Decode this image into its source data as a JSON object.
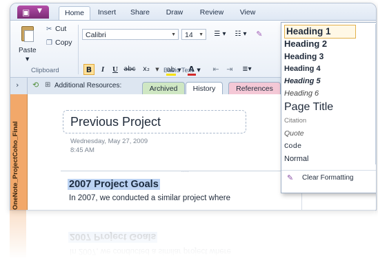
{
  "ribbon_tabs": [
    "Home",
    "Insert",
    "Share",
    "Draw",
    "Review",
    "View"
  ],
  "clipboard": {
    "paste": "Paste",
    "cut": "Cut",
    "copy": "Copy",
    "group_label": "Clipboard"
  },
  "basic_text": {
    "font_name": "Calibri",
    "font_size": "14",
    "group_label": "Basic Text",
    "bold": "B",
    "italic": "I",
    "underline": "U",
    "strike": "abc",
    "subscript": "x₂",
    "highlight_color": "#f6e000",
    "font_color": "#d22a2a"
  },
  "styles_gallery": {
    "items": [
      "Heading 1",
      "Heading 2",
      "Heading 3",
      "Heading 4",
      "Heading 5",
      "Heading 6",
      "Page Title",
      "Citation",
      "Quote",
      "Code",
      "Normal"
    ],
    "selected": "Heading 1",
    "clear_formatting": "Clear Formatting"
  },
  "page_tabs": {
    "prefix": "Additional Resources:",
    "tabs": [
      "Archived",
      "History",
      "References"
    ],
    "active": "History",
    "colors": {
      "Archived": "#cfe7c3",
      "History": "#ffffff",
      "References": "#f4c8d6"
    }
  },
  "notebook": {
    "name": "OneNote_ProjectCoho_Final",
    "color": "#f2a86a"
  },
  "page": {
    "title": "Previous Project",
    "date": "Wednesday, May 27, 2009",
    "time": "8:45 AM",
    "heading": "2007 Project Goals",
    "body": "In 2007, we conducted a similar project where"
  },
  "colors": {
    "accent_file": "#9a3a92",
    "selection": "#bcd3f3",
    "highlight_border": "#e2b04a"
  }
}
